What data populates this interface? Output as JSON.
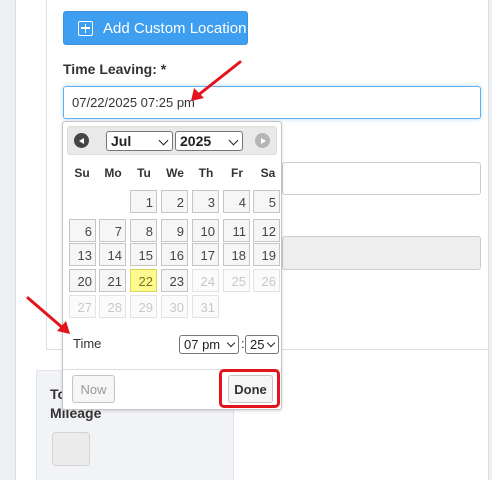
{
  "form": {
    "add_location_label": "Add Custom Location",
    "time_leaving_label": "Time Leaving: *",
    "time_leaving_value": "07/22/2025 07:25 pm"
  },
  "lower_panel": {
    "to_label": "To",
    "mileage_label": "Mileage"
  },
  "datepicker": {
    "month": "Jul",
    "year": "2025",
    "weekdays": [
      "Su",
      "Mo",
      "Tu",
      "We",
      "Th",
      "Fr",
      "Sa"
    ],
    "weeks": [
      [
        null,
        null,
        "1",
        "2",
        "3",
        "4",
        "5"
      ],
      [
        "6",
        "7",
        "8",
        "9",
        "10",
        "11",
        "12"
      ],
      [
        "13",
        "14",
        "15",
        "16",
        "17",
        "18",
        "19"
      ],
      [
        "20",
        "21",
        "22",
        "23",
        "24",
        "25",
        "26"
      ],
      [
        "27",
        "28",
        "29",
        "30",
        "31",
        null,
        null
      ]
    ],
    "today": "22",
    "first_disabled_day": "24",
    "time_label": "Time",
    "hour": "07 pm",
    "minute": "25",
    "now_label": "Now",
    "done_label": "Done"
  },
  "annotation_color": "#e3141b",
  "accent_color": "#3e9ff0"
}
